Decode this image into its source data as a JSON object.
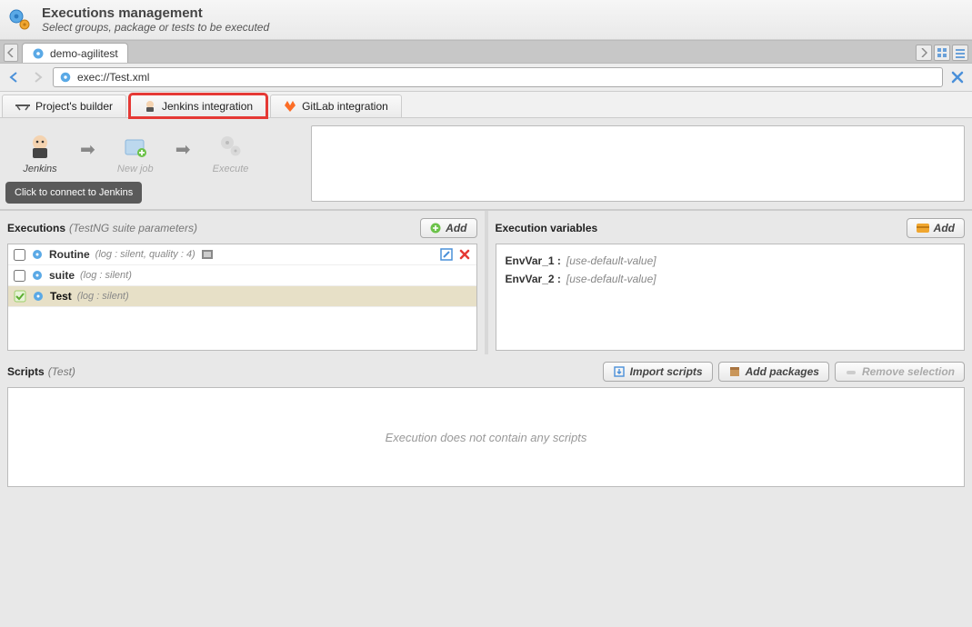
{
  "header": {
    "title": "Executions management",
    "subtitle": "Select groups, package or tests to be executed"
  },
  "tab": {
    "label": "demo-agilitest"
  },
  "url": "exec://Test.xml",
  "subtabs": {
    "builder": "Project's builder",
    "jenkins": "Jenkins integration",
    "gitlab": "GitLab integration"
  },
  "workflow": {
    "jenkins": "Jenkins",
    "newjob": "New job",
    "execute": "Execute",
    "tooltip": "Click to connect to Jenkins"
  },
  "executions": {
    "title": "Executions",
    "paren": "(TestNG suite parameters)",
    "add": "Add",
    "rows": [
      {
        "name": "Routine",
        "meta": "(log : silent, quality : 4)",
        "selected": false,
        "film": true,
        "editable": true
      },
      {
        "name": "suite",
        "meta": "(log : silent)",
        "selected": false
      },
      {
        "name": "Test",
        "meta": "(log : silent)",
        "selected": true
      }
    ]
  },
  "vars": {
    "title": "Execution variables",
    "add": "Add",
    "rows": [
      {
        "name": "EnvVar_1 :",
        "val": "[use-default-value]"
      },
      {
        "name": "EnvVar_2 :",
        "val": "[use-default-value]"
      }
    ]
  },
  "scripts": {
    "title": "Scripts",
    "paren": "(Test)",
    "import": "Import scripts",
    "addpkg": "Add packages",
    "remove": "Remove selection",
    "empty": "Execution does not contain any scripts"
  }
}
